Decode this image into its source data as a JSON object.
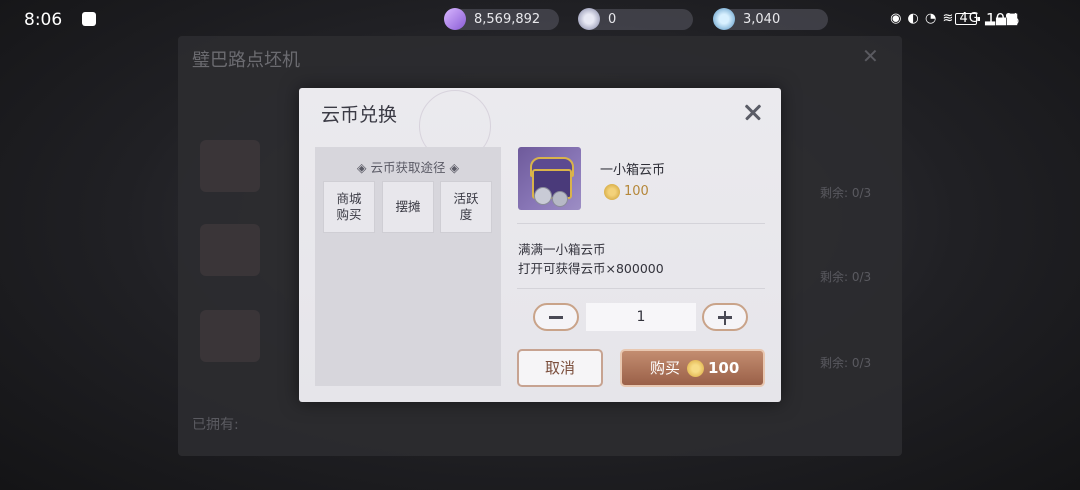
{
  "status_bar": {
    "time": "8:06",
    "battery_pct": "10%",
    "network": "4G"
  },
  "resources": [
    {
      "icon": "ticket-icon",
      "value": "8,569,892",
      "color": "#c6a4ff"
    },
    {
      "icon": "cloud-coin-icon",
      "value": "0",
      "color": "#b6b9d8"
    },
    {
      "icon": "currency-icon",
      "value": "3,040",
      "color": "#8fc4e8"
    }
  ],
  "background_page": {
    "title": "璧巴路点坯机",
    "footer": "已拥有:",
    "right_text": [
      "剩余: 0/3",
      "剩余: 0/3",
      "剩余: 0/3"
    ]
  },
  "dialog": {
    "title": "云币兑换",
    "left_panel": {
      "title": "◈ 云币获取途径 ◈",
      "sources": [
        "商城\n购买",
        "摆摊",
        "活跃\n度"
      ]
    },
    "item": {
      "name": "一小箱云币",
      "price": "100",
      "description_line1": "满满一小箱云币",
      "description_line2": "打开可获得云币×800000"
    },
    "quantity": "1",
    "cancel_label": "取消",
    "buy_label": "购买",
    "buy_price": "100",
    "accent_color": "#9a6048"
  }
}
